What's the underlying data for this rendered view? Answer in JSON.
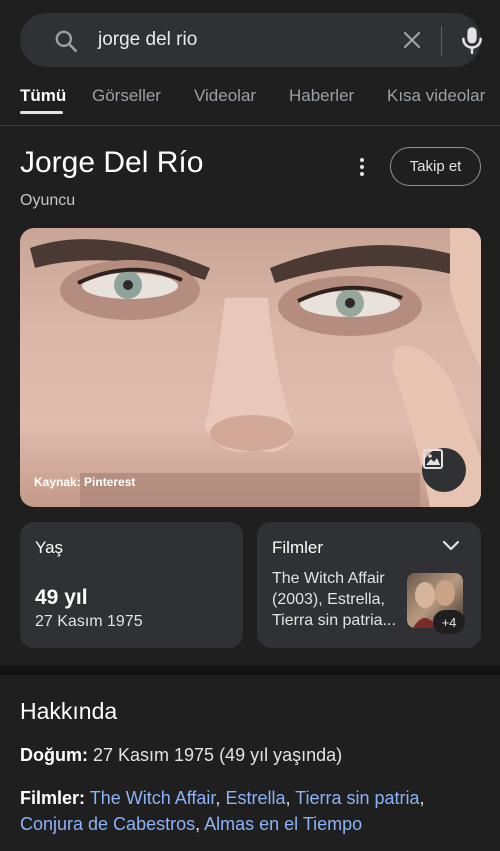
{
  "search": {
    "query": "jorge del rio"
  },
  "tabs": [
    {
      "label": "Tümü",
      "active": true
    },
    {
      "label": "Görseller"
    },
    {
      "label": "Videolar"
    },
    {
      "label": "Haberler"
    },
    {
      "label": "Kısa videolar"
    }
  ],
  "panel": {
    "title": "Jorge Del Río",
    "subtitle": "Oyuncu",
    "follow_label": "Takip et",
    "image_source": "Kaynak: Pinterest"
  },
  "age_card": {
    "title": "Yaş",
    "value": "49 yıl",
    "date": "27 Kasım 1975"
  },
  "films_card": {
    "title": "Filmler",
    "text": "The Witch Affair (2003), Estrella, Tierra sin patria...",
    "more": "+4"
  },
  "about": {
    "title": "Hakkında",
    "birth_label": "Doğum:",
    "birth_value": " 27 Kasım 1975 (49 yıl yaşında)",
    "films_label": "Filmler:",
    "films": [
      "The Witch Affair",
      "Estrella",
      "Tierra sin patria",
      "Conjura de Cabestros",
      "Almas en el Tiempo"
    ]
  },
  "colors": {
    "background": "#1f1f1f",
    "card": "#303134",
    "link": "#8ab4f8"
  }
}
